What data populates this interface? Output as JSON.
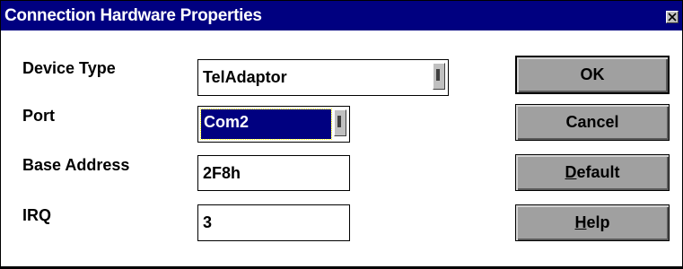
{
  "window": {
    "title": "Connection Hardware Properties"
  },
  "fields": {
    "device_type": {
      "label": "Device Type",
      "value": "TelAdaptor"
    },
    "port": {
      "label": "Port",
      "value": "Com2"
    },
    "base_address": {
      "label": "Base Address",
      "value": "2F8h"
    },
    "irq": {
      "label": "IRQ",
      "value": "3"
    }
  },
  "buttons": {
    "ok": "OK",
    "cancel": "Cancel",
    "default": {
      "mnemonic": "D",
      "rest": "efault"
    },
    "help": {
      "mnemonic": "H",
      "rest": "elp"
    }
  },
  "colors": {
    "titlebar": "#000080",
    "button_face": "#a0a0a0",
    "selection": "#000080"
  }
}
